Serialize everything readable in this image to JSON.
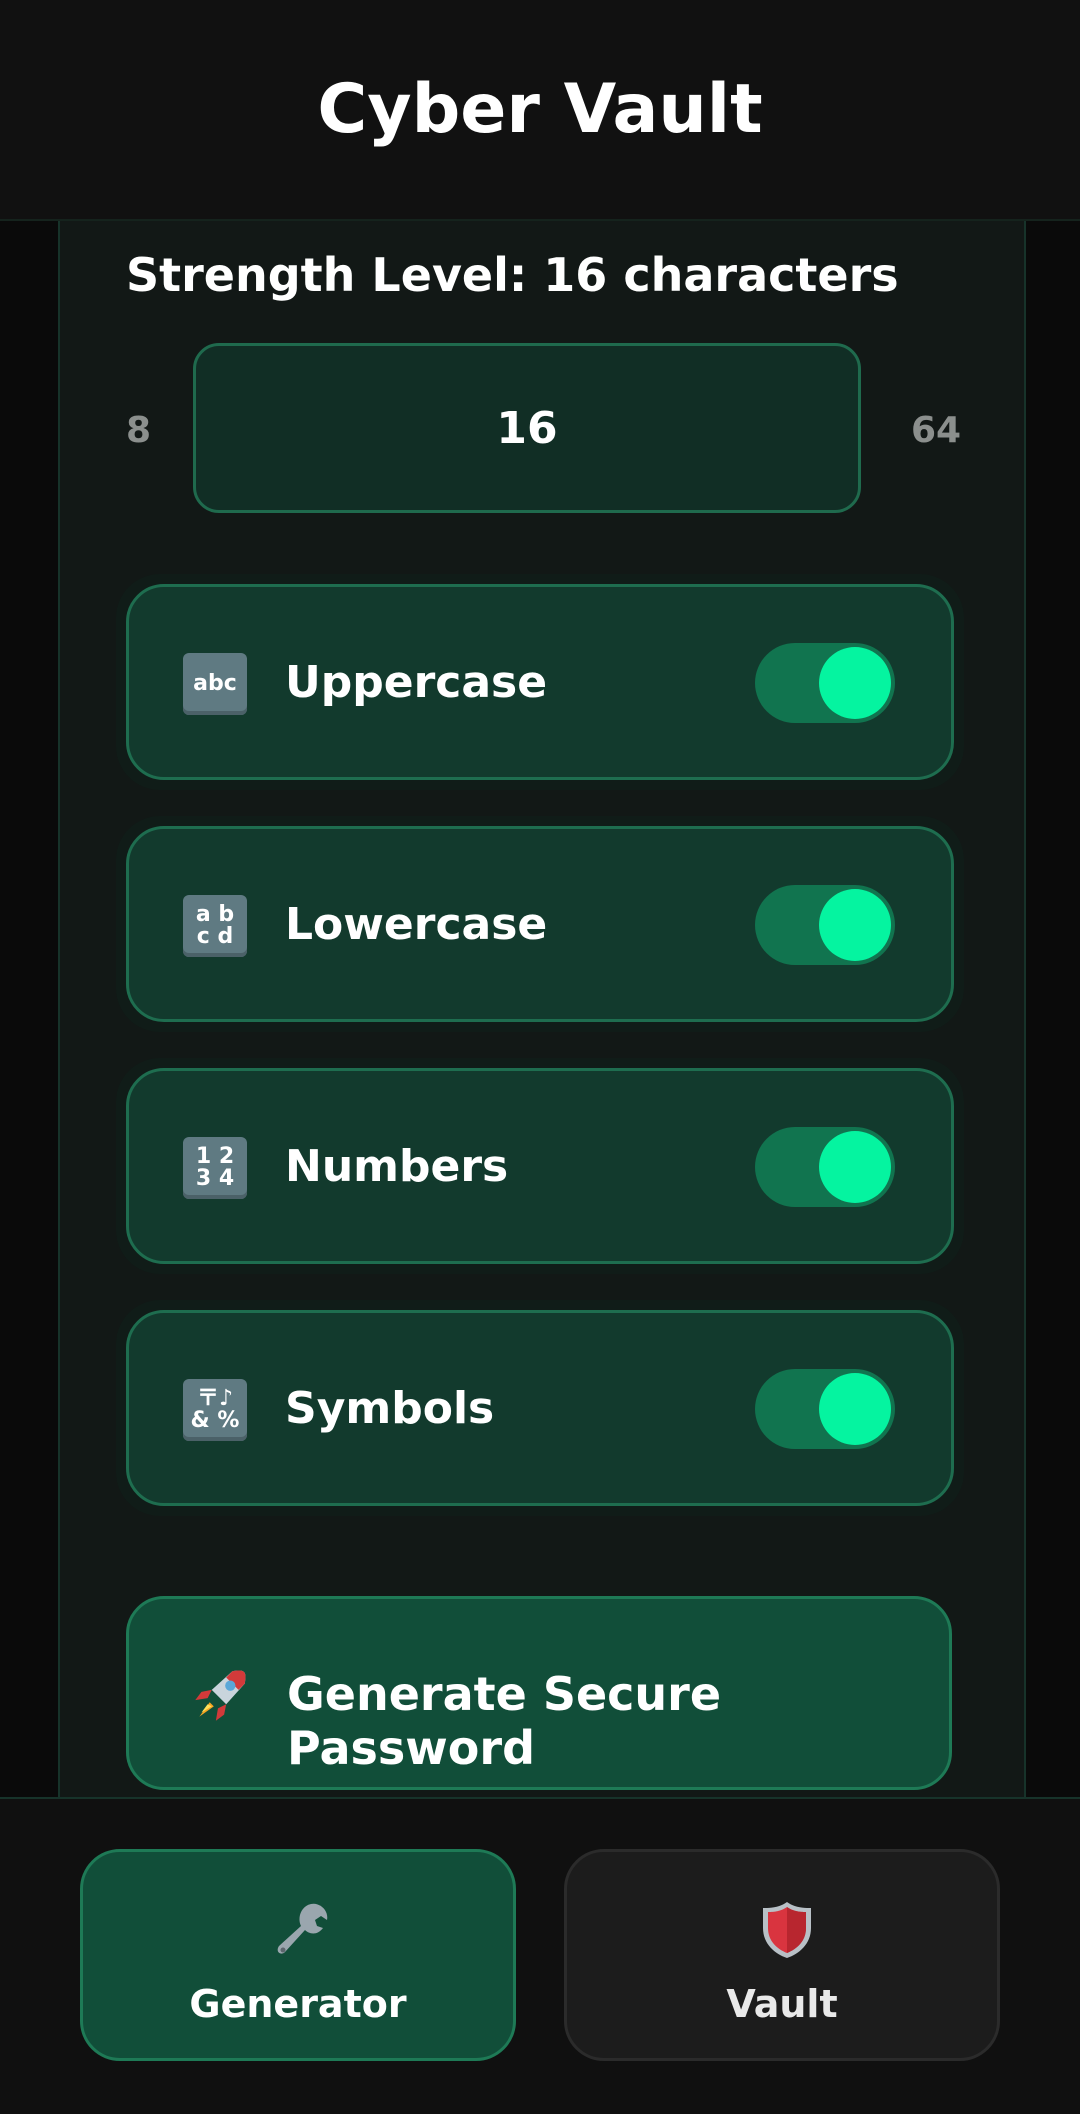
{
  "app": {
    "title": "Cyber Vault"
  },
  "generator": {
    "strength_label": "Strength Level: 16 characters",
    "length": {
      "min": "8",
      "max": "64",
      "value": "16"
    },
    "options": [
      {
        "label": "Uppercase",
        "icon": "abc-input-icon",
        "icon_text": "abc",
        "enabled": true
      },
      {
        "label": "Lowercase",
        "icon": "abcd-input-icon",
        "icon_text": "a b\nc d",
        "enabled": true
      },
      {
        "label": "Numbers",
        "icon": "numbers-input-icon",
        "icon_text": "1 2\n3 4",
        "enabled": true
      },
      {
        "label": "Symbols",
        "icon": "symbols-input-icon",
        "icon_text": "〒♪\n& %",
        "enabled": true
      }
    ],
    "generate_button": {
      "label": "Generate Secure Password",
      "icon": "rocket-icon"
    }
  },
  "bottom_nav": {
    "items": [
      {
        "label": "Generator",
        "icon": "wrench-icon",
        "active": true
      },
      {
        "label": "Vault",
        "icon": "shield-icon",
        "active": false
      }
    ]
  },
  "colors": {
    "accent": "#05f4a0",
    "card_bg": "#123a2d",
    "card_border": "#1e6d4f",
    "toggle_track": "#11744f",
    "header_bg": "#111111",
    "panel_bg": "#121816"
  }
}
